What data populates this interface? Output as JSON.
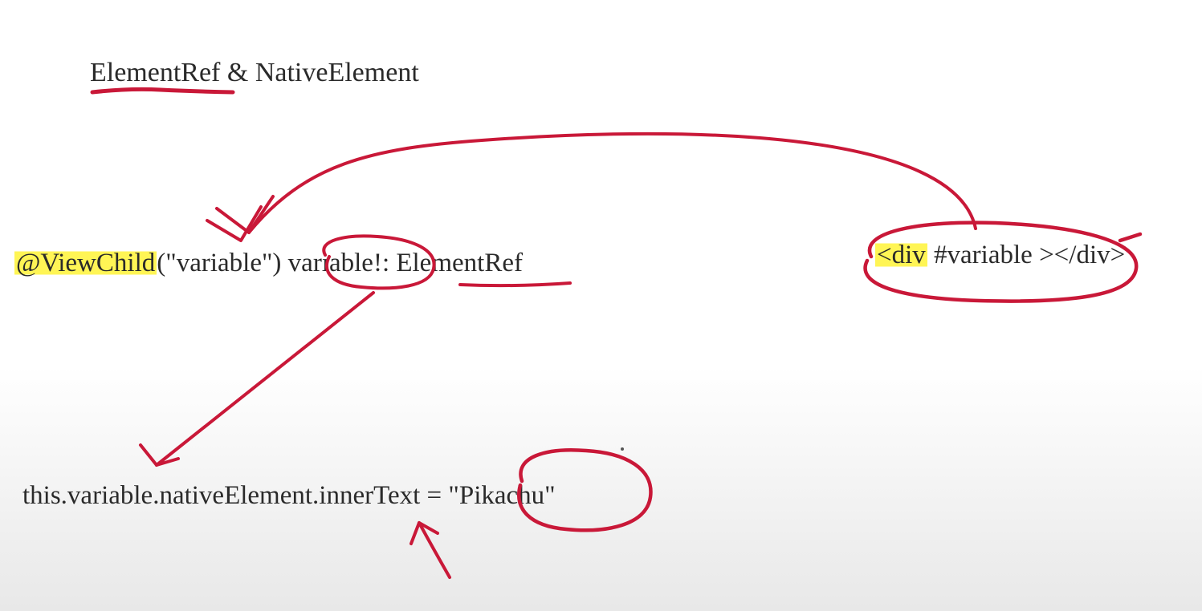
{
  "title": {
    "part1": "ElementRef",
    "amp": " & ",
    "part2": "NativeElement"
  },
  "viewchild": {
    "decorator": "@ViewChild",
    "openParen": "(\"variable\") ",
    "varName": "variable!",
    "colon": ": ",
    "type": "ElementRef"
  },
  "divTag": {
    "open": "<div",
    "space": " ",
    "ref": "#variable ",
    "close": "></div>"
  },
  "nativeElement": {
    "prefix": "this.variable.nativeElement.innerText = ",
    "value": "\"Pikachu\""
  }
}
